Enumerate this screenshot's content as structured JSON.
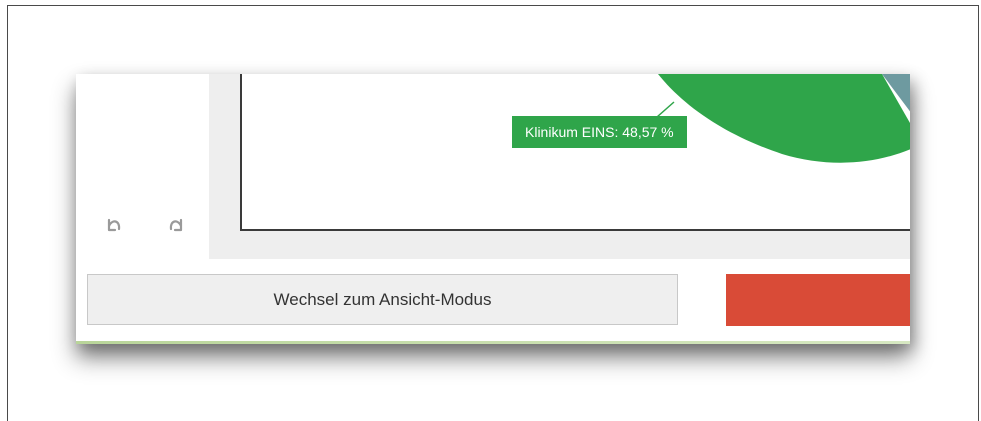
{
  "editor": {
    "chart_label": "Klinikum EINS: 48,57 %",
    "toolbar": {
      "undo_icon": "undo-icon",
      "redo_icon": "redo-icon"
    }
  },
  "footer": {
    "mode_button_label": "Wechsel zum Ansicht-Modus",
    "secondary_button_label": ""
  },
  "colors": {
    "slice_primary": "#2fa54a",
    "slice_secondary": "#6e9aa0",
    "danger": "#d94b37",
    "label_background": "#2fa54a"
  }
}
